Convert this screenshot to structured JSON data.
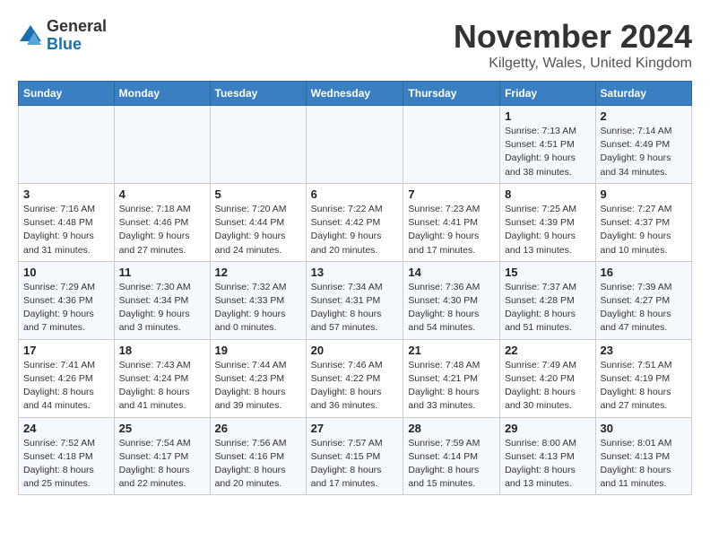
{
  "header": {
    "logo_general": "General",
    "logo_blue": "Blue",
    "month_year": "November 2024",
    "location": "Kilgetty, Wales, United Kingdom"
  },
  "columns": [
    "Sunday",
    "Monday",
    "Tuesday",
    "Wednesday",
    "Thursday",
    "Friday",
    "Saturday"
  ],
  "weeks": [
    [
      {
        "day": "",
        "info": ""
      },
      {
        "day": "",
        "info": ""
      },
      {
        "day": "",
        "info": ""
      },
      {
        "day": "",
        "info": ""
      },
      {
        "day": "",
        "info": ""
      },
      {
        "day": "1",
        "info": "Sunrise: 7:13 AM\nSunset: 4:51 PM\nDaylight: 9 hours\nand 38 minutes."
      },
      {
        "day": "2",
        "info": "Sunrise: 7:14 AM\nSunset: 4:49 PM\nDaylight: 9 hours\nand 34 minutes."
      }
    ],
    [
      {
        "day": "3",
        "info": "Sunrise: 7:16 AM\nSunset: 4:48 PM\nDaylight: 9 hours\nand 31 minutes."
      },
      {
        "day": "4",
        "info": "Sunrise: 7:18 AM\nSunset: 4:46 PM\nDaylight: 9 hours\nand 27 minutes."
      },
      {
        "day": "5",
        "info": "Sunrise: 7:20 AM\nSunset: 4:44 PM\nDaylight: 9 hours\nand 24 minutes."
      },
      {
        "day": "6",
        "info": "Sunrise: 7:22 AM\nSunset: 4:42 PM\nDaylight: 9 hours\nand 20 minutes."
      },
      {
        "day": "7",
        "info": "Sunrise: 7:23 AM\nSunset: 4:41 PM\nDaylight: 9 hours\nand 17 minutes."
      },
      {
        "day": "8",
        "info": "Sunrise: 7:25 AM\nSunset: 4:39 PM\nDaylight: 9 hours\nand 13 minutes."
      },
      {
        "day": "9",
        "info": "Sunrise: 7:27 AM\nSunset: 4:37 PM\nDaylight: 9 hours\nand 10 minutes."
      }
    ],
    [
      {
        "day": "10",
        "info": "Sunrise: 7:29 AM\nSunset: 4:36 PM\nDaylight: 9 hours\nand 7 minutes."
      },
      {
        "day": "11",
        "info": "Sunrise: 7:30 AM\nSunset: 4:34 PM\nDaylight: 9 hours\nand 3 minutes."
      },
      {
        "day": "12",
        "info": "Sunrise: 7:32 AM\nSunset: 4:33 PM\nDaylight: 9 hours\nand 0 minutes."
      },
      {
        "day": "13",
        "info": "Sunrise: 7:34 AM\nSunset: 4:31 PM\nDaylight: 8 hours\nand 57 minutes."
      },
      {
        "day": "14",
        "info": "Sunrise: 7:36 AM\nSunset: 4:30 PM\nDaylight: 8 hours\nand 54 minutes."
      },
      {
        "day": "15",
        "info": "Sunrise: 7:37 AM\nSunset: 4:28 PM\nDaylight: 8 hours\nand 51 minutes."
      },
      {
        "day": "16",
        "info": "Sunrise: 7:39 AM\nSunset: 4:27 PM\nDaylight: 8 hours\nand 47 minutes."
      }
    ],
    [
      {
        "day": "17",
        "info": "Sunrise: 7:41 AM\nSunset: 4:26 PM\nDaylight: 8 hours\nand 44 minutes."
      },
      {
        "day": "18",
        "info": "Sunrise: 7:43 AM\nSunset: 4:24 PM\nDaylight: 8 hours\nand 41 minutes."
      },
      {
        "day": "19",
        "info": "Sunrise: 7:44 AM\nSunset: 4:23 PM\nDaylight: 8 hours\nand 39 minutes."
      },
      {
        "day": "20",
        "info": "Sunrise: 7:46 AM\nSunset: 4:22 PM\nDaylight: 8 hours\nand 36 minutes."
      },
      {
        "day": "21",
        "info": "Sunrise: 7:48 AM\nSunset: 4:21 PM\nDaylight: 8 hours\nand 33 minutes."
      },
      {
        "day": "22",
        "info": "Sunrise: 7:49 AM\nSunset: 4:20 PM\nDaylight: 8 hours\nand 30 minutes."
      },
      {
        "day": "23",
        "info": "Sunrise: 7:51 AM\nSunset: 4:19 PM\nDaylight: 8 hours\nand 27 minutes."
      }
    ],
    [
      {
        "day": "24",
        "info": "Sunrise: 7:52 AM\nSunset: 4:18 PM\nDaylight: 8 hours\nand 25 minutes."
      },
      {
        "day": "25",
        "info": "Sunrise: 7:54 AM\nSunset: 4:17 PM\nDaylight: 8 hours\nand 22 minutes."
      },
      {
        "day": "26",
        "info": "Sunrise: 7:56 AM\nSunset: 4:16 PM\nDaylight: 8 hours\nand 20 minutes."
      },
      {
        "day": "27",
        "info": "Sunrise: 7:57 AM\nSunset: 4:15 PM\nDaylight: 8 hours\nand 17 minutes."
      },
      {
        "day": "28",
        "info": "Sunrise: 7:59 AM\nSunset: 4:14 PM\nDaylight: 8 hours\nand 15 minutes."
      },
      {
        "day": "29",
        "info": "Sunrise: 8:00 AM\nSunset: 4:13 PM\nDaylight: 8 hours\nand 13 minutes."
      },
      {
        "day": "30",
        "info": "Sunrise: 8:01 AM\nSunset: 4:13 PM\nDaylight: 8 hours\nand 11 minutes."
      }
    ]
  ]
}
